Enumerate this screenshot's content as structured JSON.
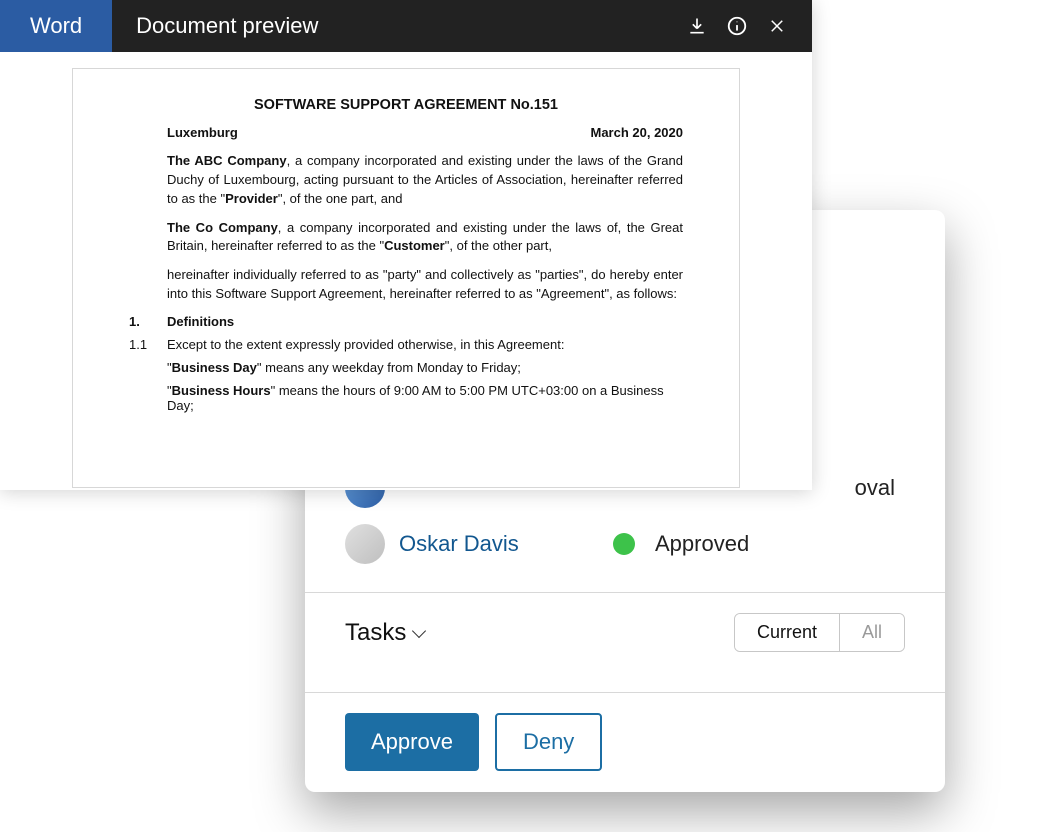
{
  "preview": {
    "badge": "Word",
    "title": "Document preview"
  },
  "document": {
    "title": "SOFTWARE SUPPORT AGREEMENT No.151",
    "location": "Luxemburg",
    "date": "March 20, 2020",
    "para1_pre": "The ABC Company",
    "para1_body": ", a company incorporated and existing under the laws of the Grand Duchy of Luxembourg, acting pursuant to the Articles of Association, hereinafter referred to as the \"",
    "para1_bold2": "Provider",
    "para1_tail": "\", of the one part, and",
    "para2_pre": "The Co Company",
    "para2_body": ", a company incorporated and existing under the laws of, the Great Britain, hereinafter referred to as the \"",
    "para2_bold2": "Customer",
    "para2_tail": "\", of the other part,",
    "para3": "hereinafter individually referred to as \"party\" and collectively as \"parties\", do hereby enter into this Software Support Agreement, hereinafter referred to as \"Agreement\", as follows:",
    "sec1_num": "1.",
    "sec1_title": "Definitions",
    "sec11_num": "1.1",
    "sec11_text": "Except to the extent expressly provided otherwise, in this Agreement:",
    "def1_q1": "\"",
    "def1_bold": "Business Day",
    "def1_tail": "\" means any weekday from Monday to Friday;",
    "def2_q1": "\"",
    "def2_bold": "Business Hours",
    "def2_tail": "\" means the hours of 9:00 AM to 5:00 PM UTC+03:00 on a Business Day;"
  },
  "approval": {
    "partial_text": "oval",
    "user": "Oskar Davis",
    "status": "Approved",
    "tasks_label": "Tasks",
    "filter_current": "Current",
    "filter_all": "All",
    "approve_btn": "Approve",
    "deny_btn": "Deny"
  }
}
